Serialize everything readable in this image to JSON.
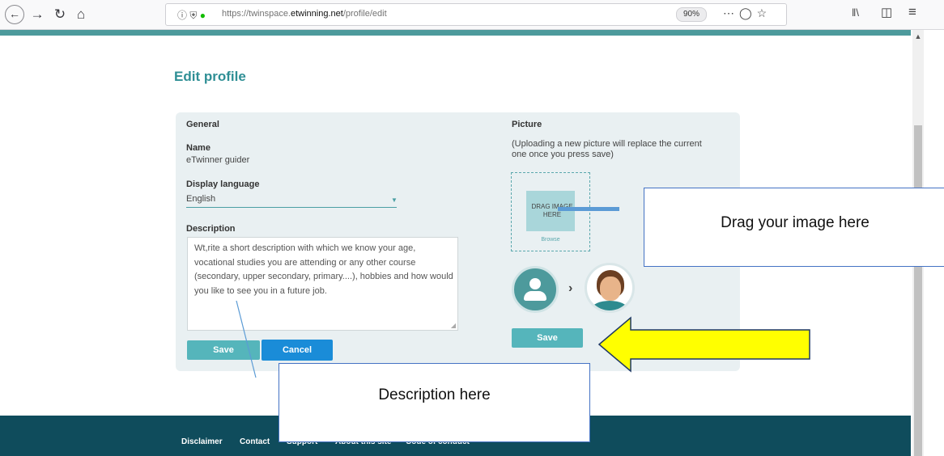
{
  "browser": {
    "url_prefix": "https://twinspace.",
    "url_domain": "etwinning.net",
    "url_path": "/profile/edit",
    "zoom": "90%",
    "icons": [
      "back-arrow-icon",
      "forward-arrow-icon",
      "reload-icon",
      "home-icon",
      "info-icon",
      "shield-icon",
      "lock-icon",
      "more-icon",
      "pocket-icon",
      "star-icon",
      "library-icon",
      "sidebar-icon",
      "menu-icon"
    ]
  },
  "page": {
    "title": "Edit profile",
    "general": {
      "heading": "General",
      "name_label": "Name",
      "name_value": "eTwinner guider",
      "language_label": "Display language",
      "language_value": "English",
      "description_label": "Description",
      "description_value": "Wt,rite a short description with which we know your age, vocational studies you are attending or any other course (secondary, upper secondary, primary....), hobbies and how would you like to see you in a future job.",
      "save_label": "Save",
      "cancel_label": "Cancel"
    },
    "picture": {
      "heading": "Picture",
      "note": "(Uploading a new picture will replace the current one once you press save)",
      "drop_text": "DRAG IMAGE HERE",
      "browse_label": "Browse",
      "save_label": "Save"
    }
  },
  "footer": {
    "links": [
      "Disclaimer",
      "Contact",
      "Support",
      "About this site",
      "Code of conduct"
    ]
  },
  "callouts": {
    "image": "Drag your image here",
    "description": "Description here"
  },
  "colors": {
    "teal": "#4d9a9c",
    "footer": "#0f4c5c",
    "cancel": "#1a8cd8",
    "arrow_fill": "#ffff00"
  }
}
